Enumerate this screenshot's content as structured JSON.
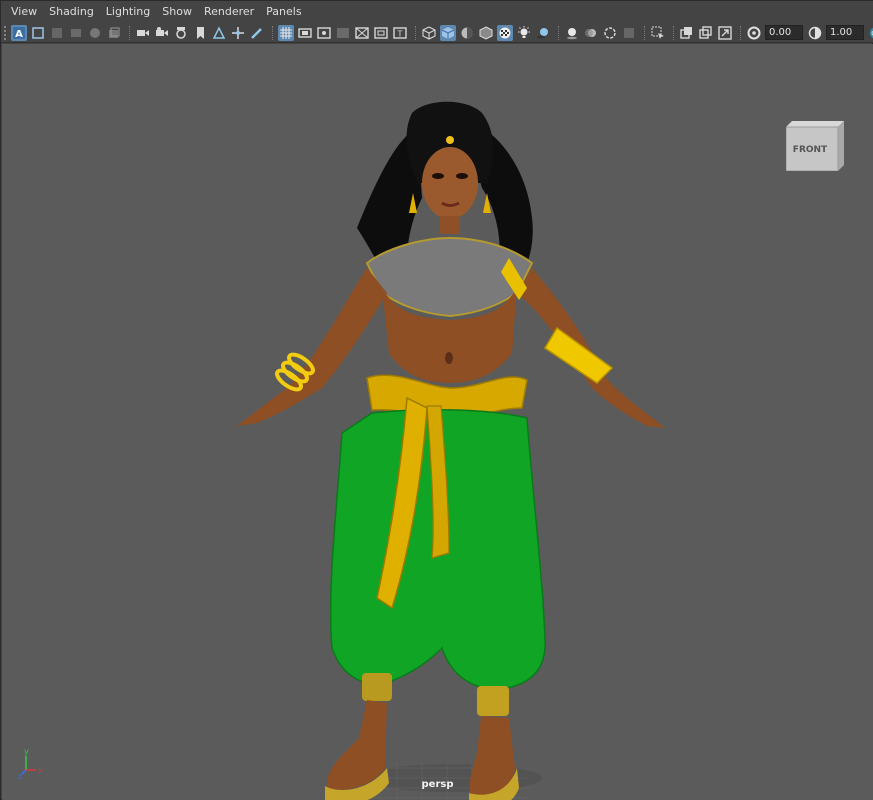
{
  "menubar": {
    "items": [
      "View",
      "Shading",
      "Lighting",
      "Show",
      "Renderer",
      "Panels"
    ]
  },
  "toolbar": {
    "exposure_value": "0.00",
    "gamma_value": "1.00"
  },
  "viewport": {
    "camera_label": "persp",
    "viewcube_face": "FRONT",
    "axis_y": "y",
    "axis_x": "x",
    "axis_z": "z"
  },
  "colors": {
    "menu_bg": "#444444",
    "viewport_bg": "#5b5b5b",
    "active_button": "#5d88b0"
  }
}
